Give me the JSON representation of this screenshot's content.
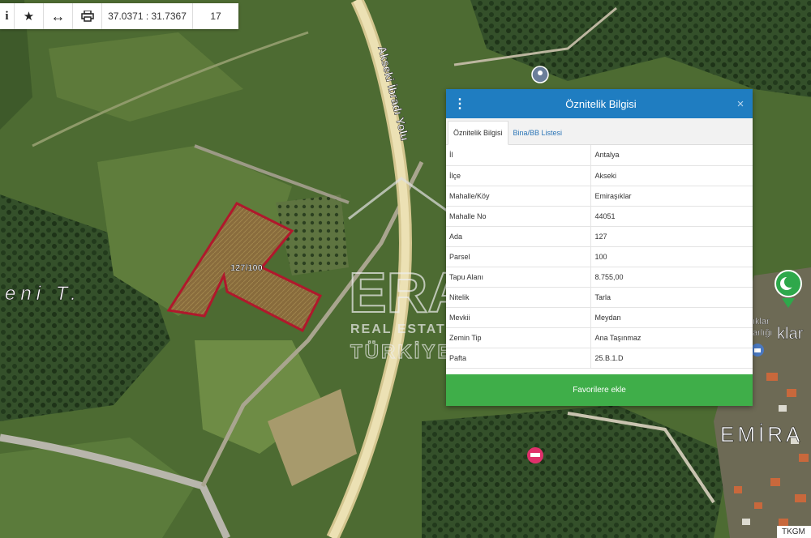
{
  "toolbar": {
    "info_icon": "i",
    "favorite_icon": "★",
    "measure_icon": "↔",
    "print_icon": "⎙",
    "coordinates": "37.0371 : 31.7367",
    "zoom": "17"
  },
  "map": {
    "road_label": "Akseki İbradı Yolu",
    "parcel_label": "127/100",
    "place_label_left": "eni T.",
    "place_label_right": "EMİRA",
    "place_label_right2": "klar",
    "place_label_right3": "ıklar",
    "place_label_right4": "arlığı",
    "watermark_title": "ERA",
    "watermark_line1": "REAL ESTATE",
    "watermark_line2": "TÜRKİYE",
    "attribution": "TKGM"
  },
  "panel": {
    "title": "Öznitelik Bilgisi",
    "close_icon": "×",
    "menu_icon": "⋮",
    "tabs": [
      {
        "label": "Öznitelik Bilgisi",
        "active": true
      },
      {
        "label": "Bina/BB Listesi",
        "active": false
      }
    ],
    "rows": [
      {
        "key": "İl",
        "value": "Antalya"
      },
      {
        "key": "İlçe",
        "value": "Akseki"
      },
      {
        "key": "Mahalle/Köy",
        "value": "Emiraşıklar"
      },
      {
        "key": "Mahalle No",
        "value": "44051"
      },
      {
        "key": "Ada",
        "value": "127"
      },
      {
        "key": "Parsel",
        "value": "100"
      },
      {
        "key": "Tapu Alanı",
        "value": "8.755,00"
      },
      {
        "key": "Nitelik",
        "value": "Tarla"
      },
      {
        "key": "Mevkii",
        "value": "Meydan"
      },
      {
        "key": "Zemin Tip",
        "value": "Ana Taşınmaz"
      },
      {
        "key": "Pafta",
        "value": "25.B.1.D"
      }
    ],
    "favorite_button": "Favorilere ekle"
  },
  "colors": {
    "header_blue": "#1f7dc1",
    "favorite_green": "#3fae49",
    "parcel_outline": "#b0182c",
    "road": "#e8dcae"
  }
}
